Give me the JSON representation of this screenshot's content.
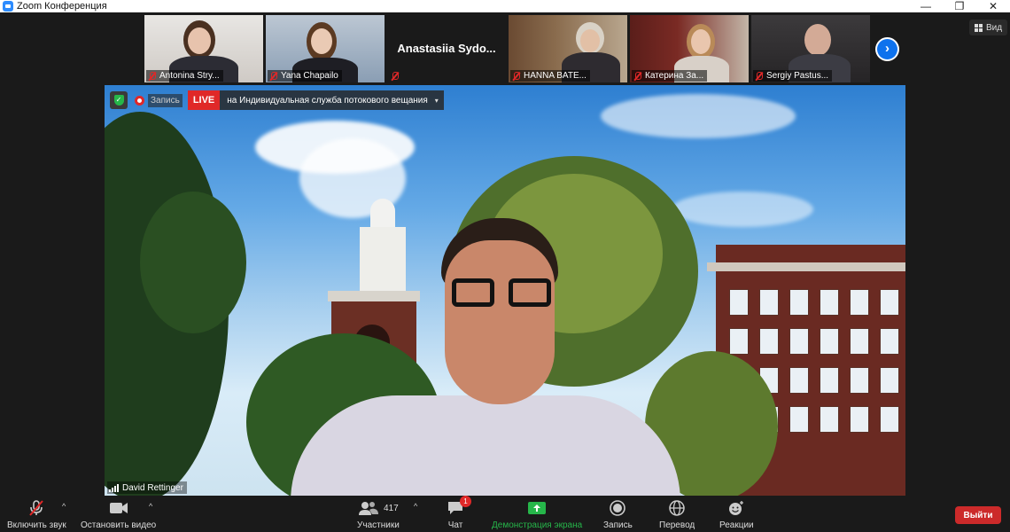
{
  "window": {
    "title": "Zoom Конференция",
    "minimize": "—",
    "restore": "❐",
    "close": "✕"
  },
  "view_button": {
    "label": "Вид"
  },
  "participants_strip": [
    {
      "name": "Antonina Stry...",
      "muted": true
    },
    {
      "name": "Yana Chapailo",
      "muted": true
    },
    {
      "name": "Anastasiia  Sydo...",
      "muted": true,
      "video_off": true
    },
    {
      "name": "HANNA BATE...",
      "muted": true
    },
    {
      "name": "Катерина За...",
      "muted": true
    },
    {
      "name": "Sergiy Pastus...",
      "muted": true
    }
  ],
  "next_page_glyph": "›",
  "main_video": {
    "recording_label": "Запись",
    "live_badge": "LIVE",
    "live_text": "на Индивидуальная служба потокового вещания",
    "live_caret": "▾",
    "speaker_name": "David Rettinger"
  },
  "toolbar": {
    "mic": {
      "label": "Включить звук",
      "caret": "^"
    },
    "video": {
      "label": "Остановить видео",
      "caret": "^"
    },
    "participants": {
      "label": "Участники",
      "count": "417",
      "caret": "^"
    },
    "chat": {
      "label": "Чат",
      "badge": "1"
    },
    "share": {
      "label": "Демонстрация экрана"
    },
    "record": {
      "label": "Запись"
    },
    "translate": {
      "label": "Перевод"
    },
    "reactions": {
      "label": "Реакции"
    },
    "exit": {
      "label": "Выйти"
    }
  },
  "colors": {
    "zoom_blue": "#0e72ed",
    "live_red": "#e02828",
    "share_green": "#26b64a",
    "exit_red": "#cc2a2a",
    "background": "#1a1a1a"
  }
}
